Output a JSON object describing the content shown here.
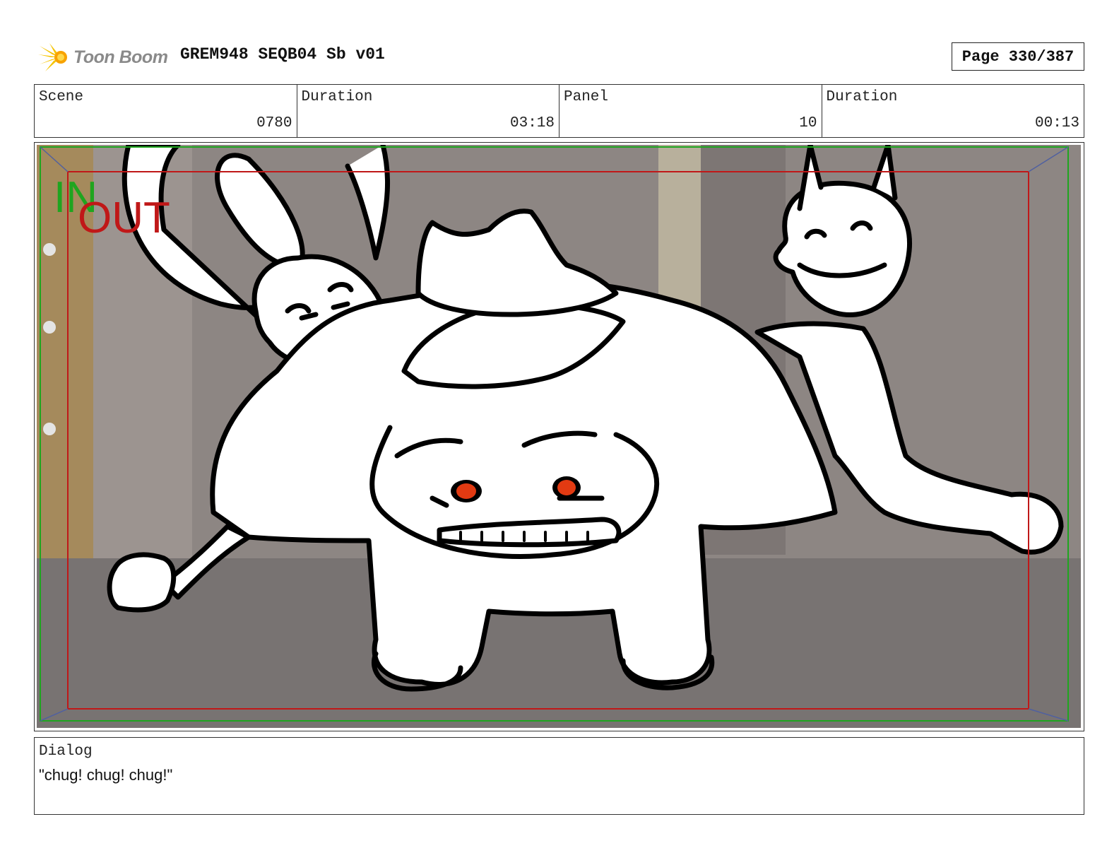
{
  "header": {
    "logo_text": "Toon Boom",
    "logo_icon": "starburst-icon",
    "title": "GREM948 SEQB04 Sb v01",
    "page": "Page 330/387"
  },
  "info": {
    "scene_label": "Scene",
    "scene_value": "0780",
    "duration_label": "Duration",
    "duration_value": "03:18",
    "panel_label": "Panel",
    "panel_value": "10",
    "panel_duration_label": "Duration",
    "panel_duration_value": "00:13"
  },
  "panel": {
    "in_label": "IN",
    "out_label": "OUT",
    "colors": {
      "in": "#1fa51f",
      "out": "#c01818",
      "eye": "#e23a12"
    }
  },
  "dialog": {
    "label": "Dialog",
    "text": "\"chug! chug! chug!\""
  }
}
